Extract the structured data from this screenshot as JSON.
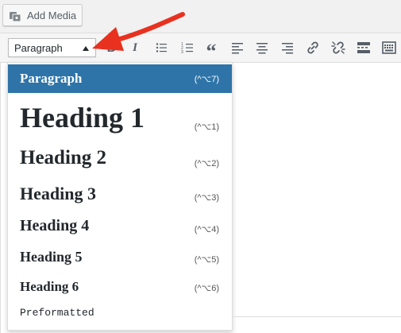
{
  "toolbar": {
    "add_media_label": "Add Media",
    "format_select": {
      "selected": "Paragraph"
    },
    "buttons": [
      {
        "name": "bold-icon",
        "label": "B"
      },
      {
        "name": "italic-icon",
        "label": "I"
      },
      {
        "name": "bulleted-list-icon"
      },
      {
        "name": "numbered-list-icon"
      },
      {
        "name": "blockquote-icon",
        "label": "“"
      },
      {
        "name": "align-left-icon"
      },
      {
        "name": "align-center-icon"
      },
      {
        "name": "align-right-icon"
      },
      {
        "name": "insert-link-icon"
      },
      {
        "name": "remove-link-icon"
      },
      {
        "name": "read-more-icon"
      },
      {
        "name": "toolbar-toggle-icon"
      }
    ]
  },
  "dropdown": {
    "items": [
      {
        "label": "Paragraph",
        "shortcut": "(^⌥7)",
        "selected": true
      },
      {
        "label": "Heading 1",
        "shortcut": "(^⌥1)"
      },
      {
        "label": "Heading 2",
        "shortcut": "(^⌥2)"
      },
      {
        "label": "Heading 3",
        "shortcut": "(^⌥3)"
      },
      {
        "label": "Heading 4",
        "shortcut": "(^⌥4)"
      },
      {
        "label": "Heading 5",
        "shortcut": "(^⌥5)"
      },
      {
        "label": "Heading 6",
        "shortcut": "(^⌥6)"
      },
      {
        "label": "Preformatted",
        "shortcut": ""
      }
    ]
  },
  "colors": {
    "selected_bg": "#2e74a8",
    "annotation_arrow": "#e8311f"
  }
}
